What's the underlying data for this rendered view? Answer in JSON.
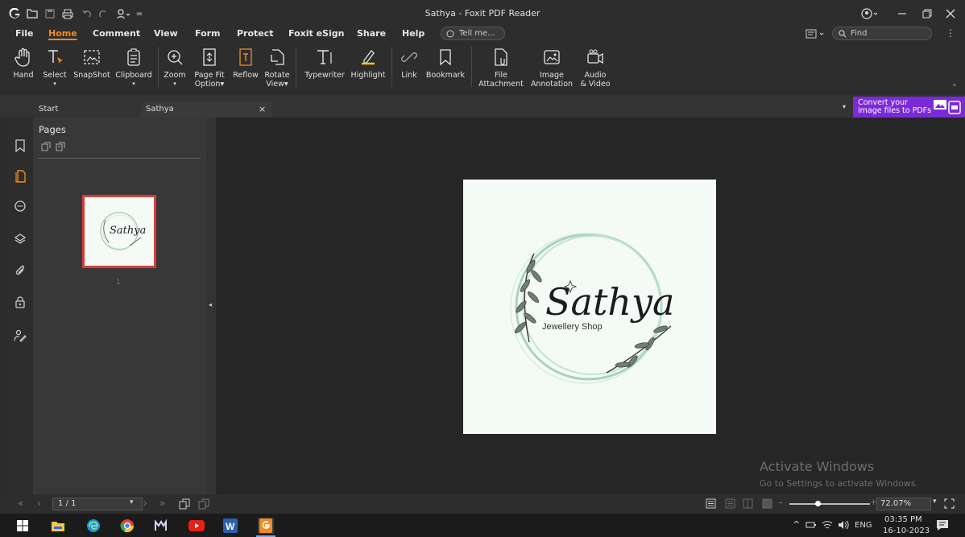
{
  "window": {
    "title": "Sathya - Foxit PDF Reader",
    "user_icon": "user-circle-icon",
    "controls": [
      "minimize-icon",
      "restore-icon",
      "close-icon"
    ]
  },
  "menu": {
    "tabs": [
      "File",
      "Home",
      "Comment",
      "View",
      "Form",
      "Protect",
      "Foxit eSign",
      "Share",
      "Help"
    ],
    "active_tab": "Home",
    "tell_me_placeholder": "Tell me...",
    "find_placeholder": "Find"
  },
  "ribbon": {
    "hand": "Hand",
    "select": "Select",
    "snapshot": "SnapShot",
    "clipboard": "Clipboard",
    "zoom": "Zoom",
    "page_fit_line1": "Page Fit",
    "page_fit_line2": "Option",
    "reflow": "Reflow",
    "rotate_line1": "Rotate",
    "rotate_line2": "View",
    "typewriter": "Typewriter",
    "highlight": "Highlight",
    "link": "Link",
    "bookmark": "Bookmark",
    "file_attachment_line1": "File",
    "file_attachment_line2": "Attachment",
    "image_annotation_line1": "Image",
    "image_annotation_line2": "Annotation",
    "audio_video_line1": "Audio",
    "audio_video_line2": "& Video"
  },
  "doc_tabs": {
    "start": "Start",
    "current": "Sathya",
    "promo_line1": "Convert your",
    "promo_line2": "image files to PDFs"
  },
  "pages_panel": {
    "title": "Pages",
    "thumbnail_label": "1"
  },
  "document": {
    "logo_title": "Sathya",
    "logo_subtitle": "Jewellery Shop"
  },
  "watermark": {
    "line1": "Activate Windows",
    "line2": "Go to Settings to activate Windows."
  },
  "status": {
    "page_indicator": "1 / 1",
    "zoom_level": "72.07%"
  },
  "taskbar": {
    "language": "ENG",
    "time": "03:35 PM",
    "date": "16-10-2023"
  }
}
